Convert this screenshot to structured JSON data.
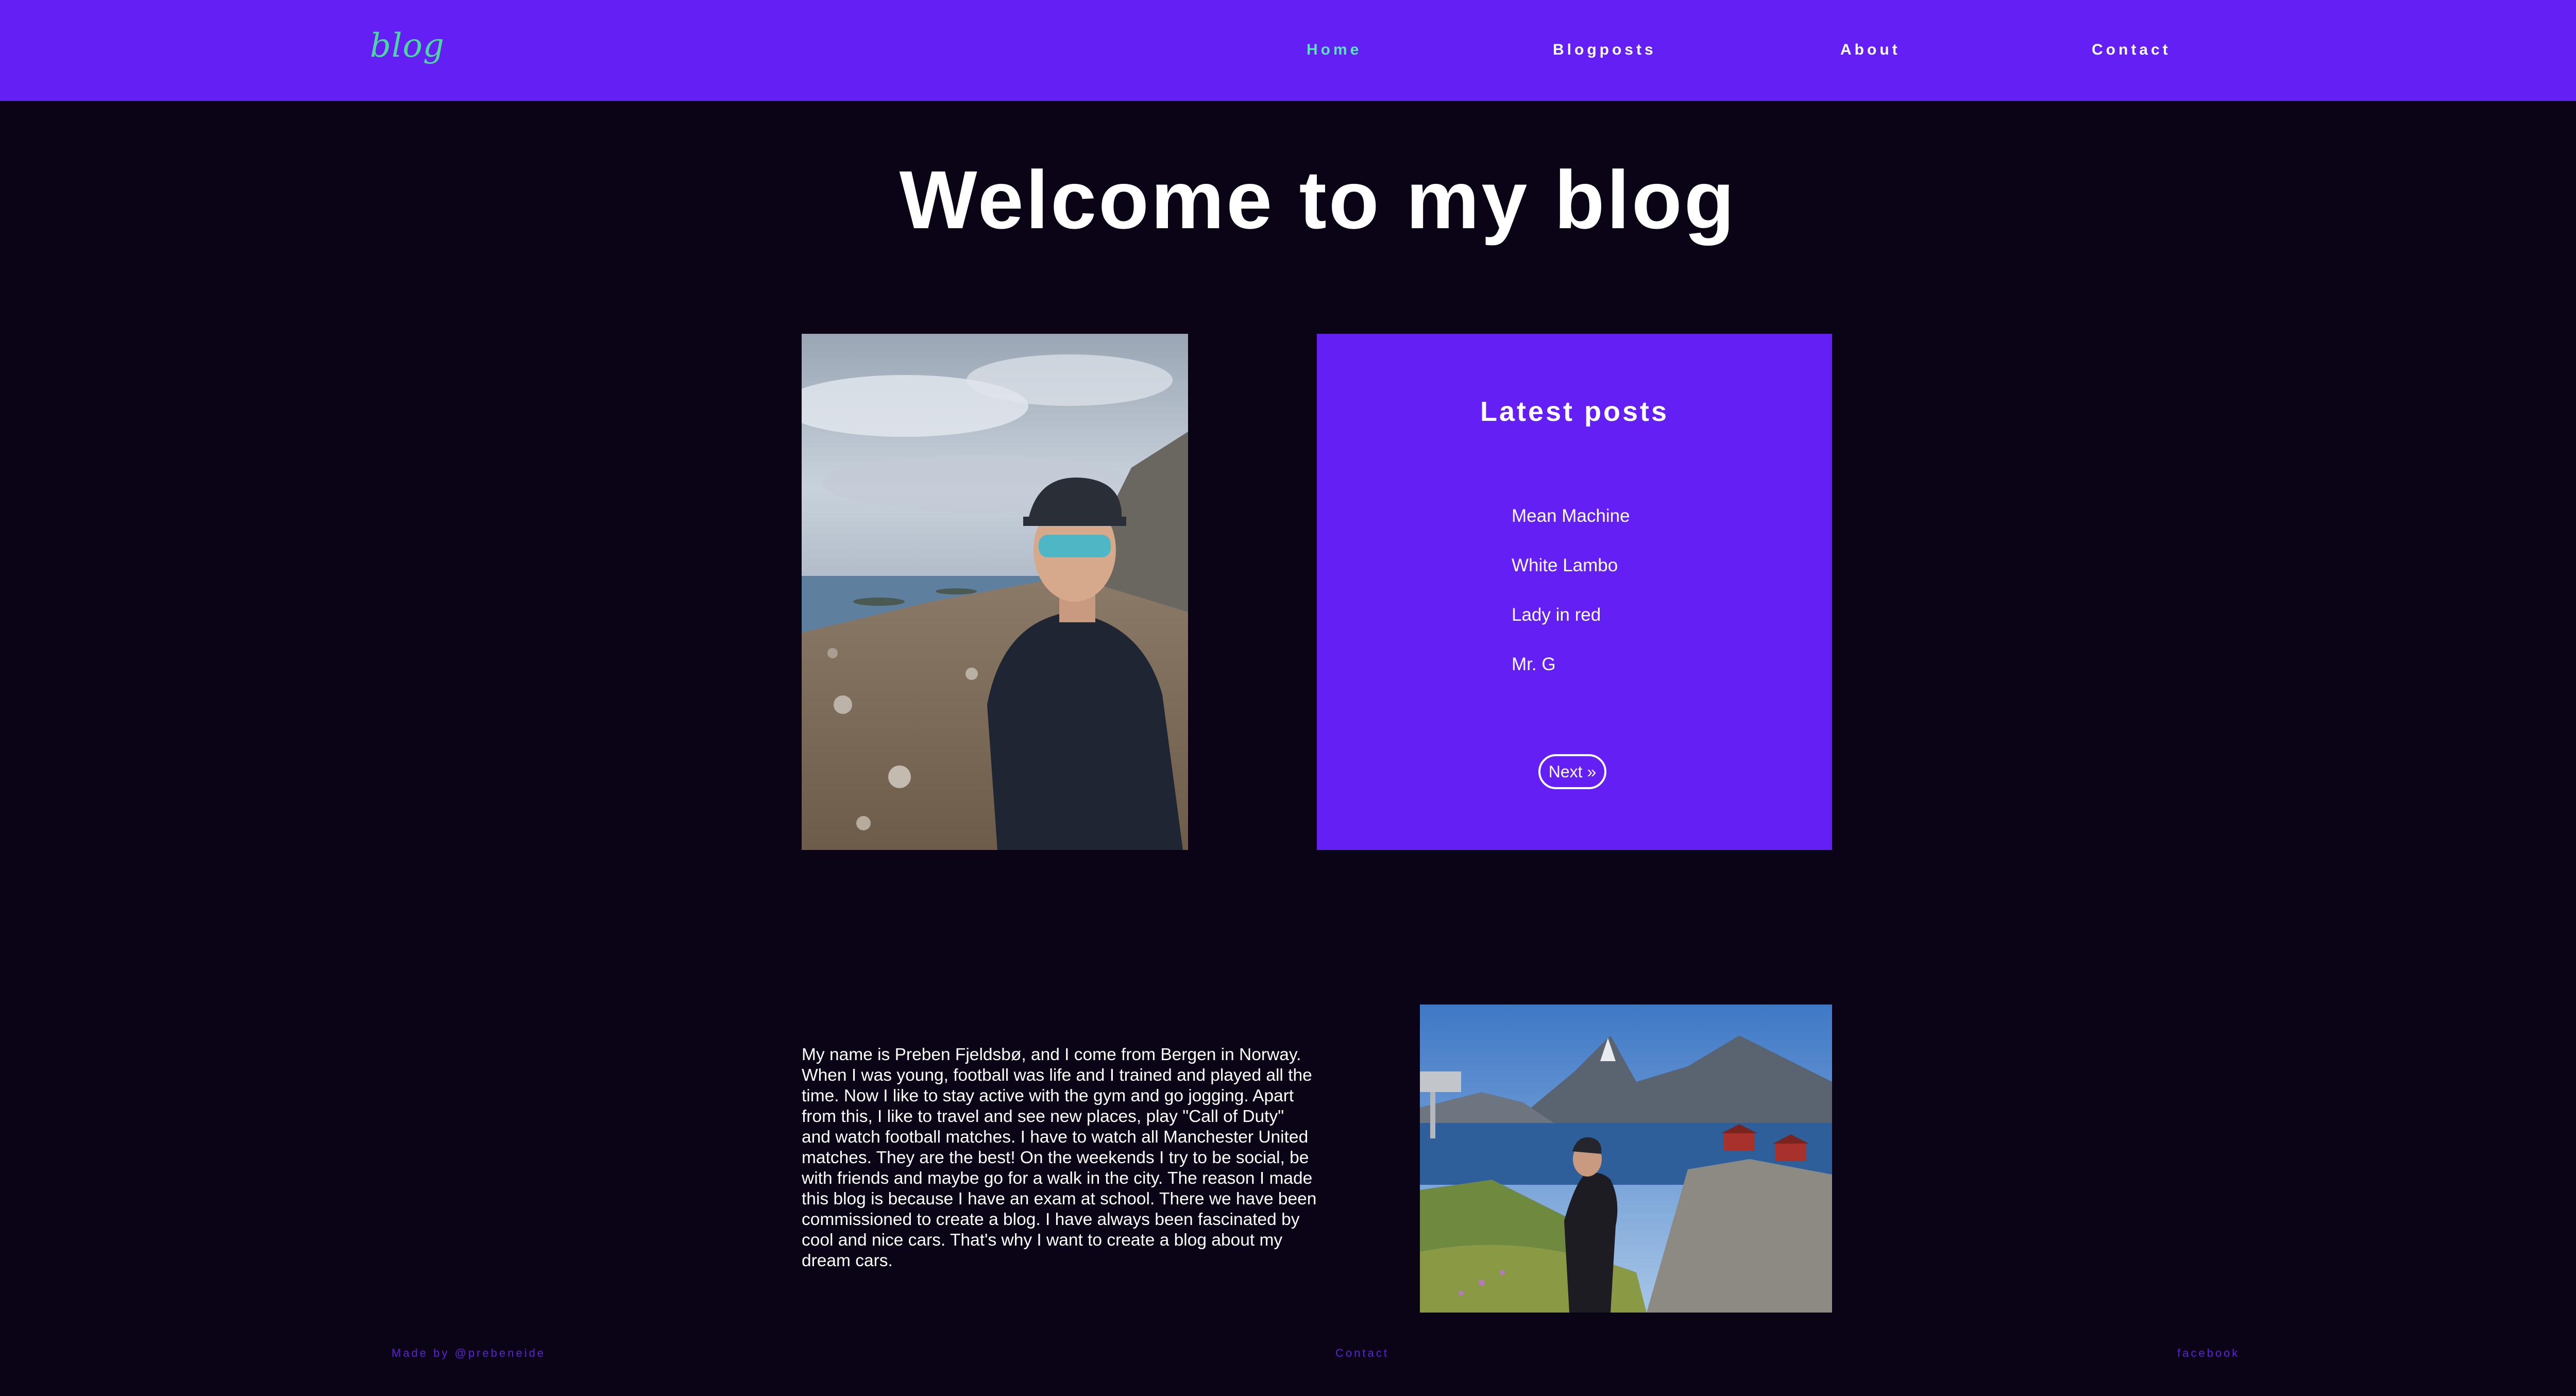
{
  "header": {
    "logo": "blog",
    "nav": [
      {
        "label": "Home",
        "active": true
      },
      {
        "label": "Blogposts",
        "active": false
      },
      {
        "label": "About",
        "active": false
      },
      {
        "label": "Contact",
        "active": false
      }
    ]
  },
  "hero": {
    "title": "Welcome to my blog"
  },
  "latest_posts": {
    "title": "Latest posts",
    "items": [
      "Mean Machine",
      "White Lambo",
      "Lady in red",
      "Mr. G"
    ],
    "next_label": "Next »"
  },
  "about": {
    "text": "My name is Preben Fjeldsbø, and I come from Bergen in Norway. When I was young, football was life and I trained and played all the time. Now I like to stay active with the gym and go jogging. Apart from this, I like to travel and see new places, play \"Call of Duty\" and watch football matches. I have to watch all Manchester United matches. They are the best! On the weekends I try to be social, be with friends and maybe go for a walk in the city. The reason I made this blog is because I have an exam at school. There we have been commissioned to create a blog. I have always been fascinated by cool and nice cars. That's why I want to create a blog about my dream cars."
  },
  "footer": {
    "credit": "Made by @prebeneide",
    "contact": "Contact",
    "facebook": "facebook"
  },
  "colors": {
    "primary": "#6420f4",
    "background": "#0b0416",
    "logo": "#4dd6a3",
    "active_nav": "#59e3c0",
    "footer_text": "#5a22d8"
  }
}
